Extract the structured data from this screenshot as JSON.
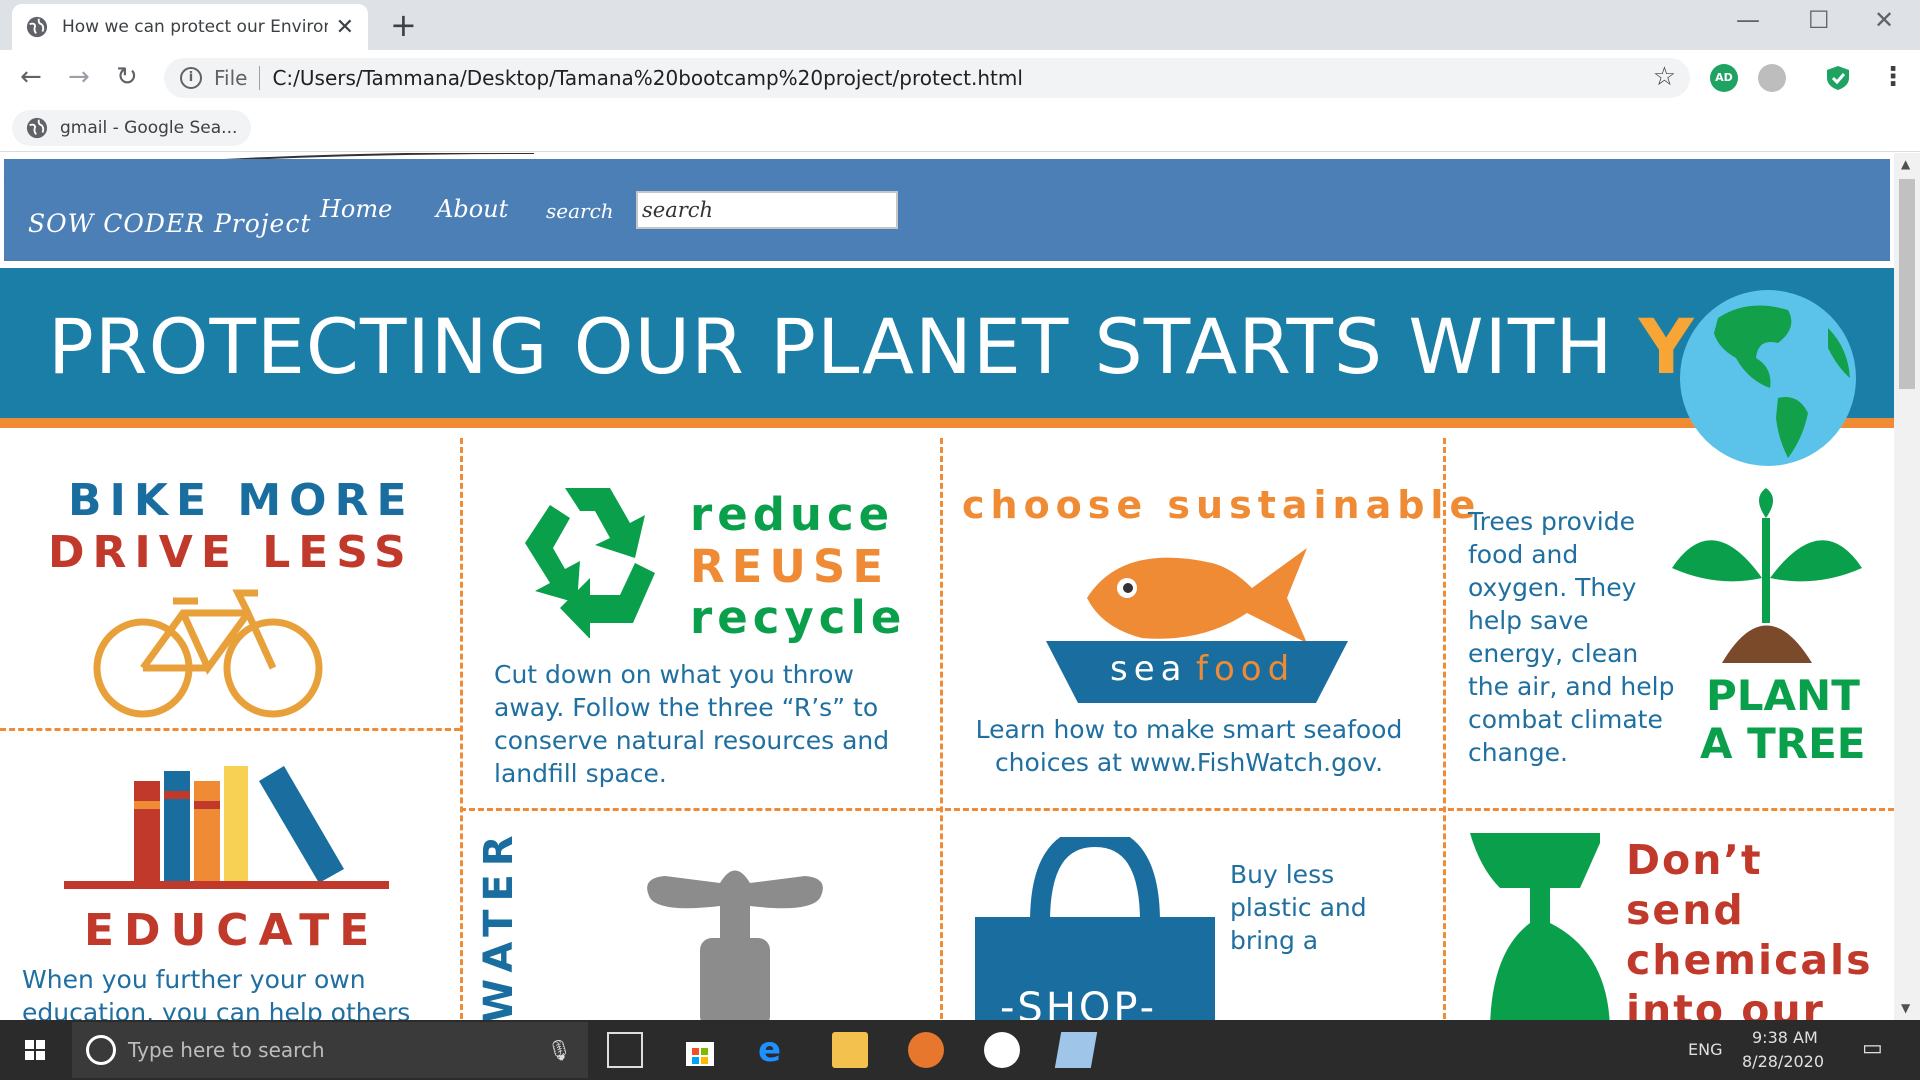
{
  "browser": {
    "tab_title": "How we can protect our Environm",
    "address_label": "File",
    "url": "C:/Users/Tammana/Desktop/Tamana%20bootcamp%20project/protect.html",
    "bookmark_label": "gmail - Google Sea..."
  },
  "site": {
    "brand": "SOW CODER Project",
    "nav": [
      "Home",
      "About",
      "search"
    ],
    "search_placeholder": "search"
  },
  "hero": {
    "title": "PROTECTING OUR PLANET STARTS WITH",
    "highlight": "YOU"
  },
  "cards": {
    "bike": {
      "line1": "BIKE MORE",
      "line2": "DRIVE LESS"
    },
    "recycle": {
      "w1": "reduce",
      "w2": "REUSE",
      "w3": "recycle",
      "text": "Cut down on what you throw away.  Follow the three “R’s” to conserve natural resources and landfill space."
    },
    "seafood": {
      "heading": "choose sustainable",
      "sea": "sea",
      "food": "food",
      "text": "Learn how to make smart seafood choices at www.FishWatch.gov."
    },
    "tree": {
      "text": "Trees provide food and oxygen. They help save energy, clean the air, and help combat climate change.",
      "line1": "PLANT",
      "line2": "A TREE"
    },
    "educate": {
      "heading": "EDUCATE",
      "text": "When you further your own education, you can help others"
    },
    "water": {
      "label": "WATER"
    },
    "shop": {
      "label": "-SHOP-",
      "text": "Buy less plastic and bring a"
    },
    "chemicals": {
      "text": "Don’t send chemicals into our waterways."
    }
  },
  "taskbar": {
    "search_placeholder": "Type here to search",
    "language": "ENG",
    "time": "9:38 AM",
    "date": "8/28/2020"
  },
  "colors": {
    "nav_blue": "#4b7fb5",
    "hero_blue": "#1a7ea6",
    "orange": "#ef8b34",
    "yellow": "#f7a534",
    "green": "#0aa04b",
    "red": "#c0392b",
    "text_blue": "#1f6fa0"
  }
}
